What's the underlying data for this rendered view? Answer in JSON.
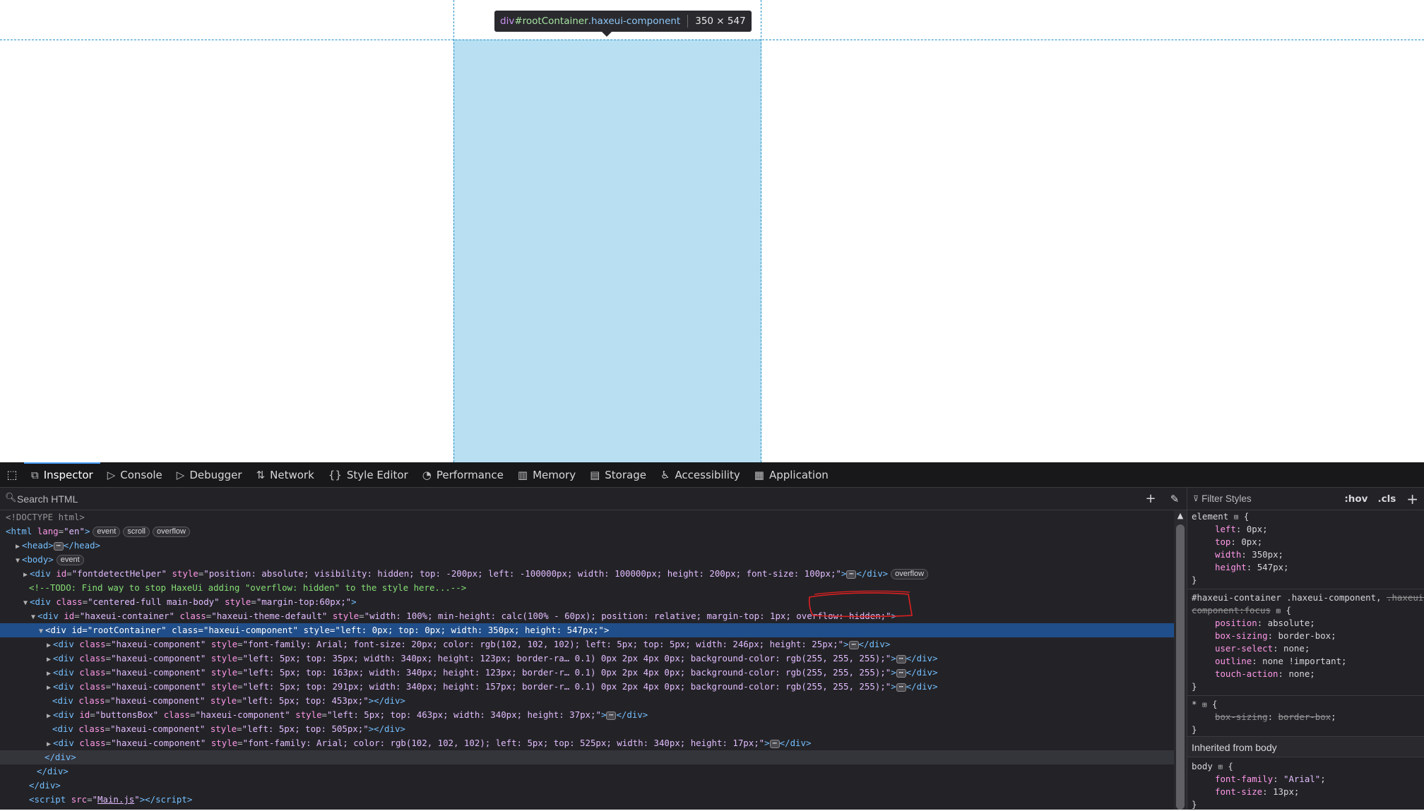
{
  "tooltip": {
    "tag": "div",
    "id": "#rootContainer",
    "classes": ".haxeui-component",
    "dims": "350 × 547"
  },
  "tabs": [
    {
      "label": "Inspector",
      "icon": "inspector-icon",
      "glyph": "⧉",
      "active": true
    },
    {
      "label": "Console",
      "icon": "console-icon",
      "glyph": "▷"
    },
    {
      "label": "Debugger",
      "icon": "debugger-icon",
      "glyph": "▷"
    },
    {
      "label": "Network",
      "icon": "network-icon",
      "glyph": "⇅"
    },
    {
      "label": "Style Editor",
      "icon": "style-editor-icon",
      "glyph": "{}"
    },
    {
      "label": "Performance",
      "icon": "performance-icon",
      "glyph": "◔"
    },
    {
      "label": "Memory",
      "icon": "memory-icon",
      "glyph": "▥"
    },
    {
      "label": "Storage",
      "icon": "storage-icon",
      "glyph": "▤"
    },
    {
      "label": "Accessibility",
      "icon": "accessibility-icon",
      "glyph": "♿"
    },
    {
      "label": "Application",
      "icon": "application-icon",
      "glyph": "▦"
    }
  ],
  "search_html": {
    "placeholder": "Search HTML"
  },
  "markup_lines": [
    {
      "html": "<span class=\"doc\">&lt;!DOCTYPE html&gt;</span>",
      "indent": 0
    },
    {
      "html": "<span class=\"tag\">&lt;html</span> <span class=\"attr\">lang</span>=<span class=\"val\">\"en\"</span><span class=\"tag\">&gt;</span><span class=\"badge\">event</span><span class=\"badge\">scroll</span><span class=\"badge\">overflow</span>",
      "indent": 0
    },
    {
      "html": "<span class=\"tw\">▶</span><span class=\"tag\">&lt;head&gt;</span><span class=\"ell\">⋯</span><span class=\"tag\">&lt;/head&gt;</span>",
      "indent": 1
    },
    {
      "html": "<span class=\"tw\">▼</span><span class=\"tag\">&lt;body&gt;</span><span class=\"badge\">event</span>",
      "indent": 1
    },
    {
      "html": "<span class=\"tw\">▶</span><span class=\"tag\">&lt;div</span> <span class=\"attr\">id</span>=<span class=\"val\">\"fontdetectHelper\"</span> <span class=\"attr\">style</span>=<span class=\"val\">\"position: absolute; visibility: hidden; top: -200px; left: -100000px; width: 100000px; height: 200px; font-size: 100px;\"</span><span class=\"tag\">&gt;</span><span class=\"ell\">⋯</span><span class=\"tag\">&lt;/div&gt;</span><span class=\"badge\">overflow</span>",
      "indent": 2
    },
    {
      "html": "<span class=\"com\">&lt;!--TODO: Find way to stop HaxeUi adding \"overflow: hidden\" to the style here...--&gt;</span>",
      "indent": 3
    },
    {
      "html": "<span class=\"tw\">▼</span><span class=\"tag\">&lt;div</span> <span class=\"attr\">class</span>=<span class=\"val\">\"centered-full main-body\"</span> <span class=\"attr\">style</span>=<span class=\"val\">\"margin-top:60px;\"</span><span class=\"tag\">&gt;</span>",
      "indent": 2
    },
    {
      "html": "<span class=\"tw\">▼</span><span class=\"tag\">&lt;div</span> <span class=\"attr\">id</span>=<span class=\"val\">\"haxeui-container\"</span> <span class=\"attr\">class</span>=<span class=\"val\">\"haxeui-theme-default\"</span> <span class=\"attr\">style</span>=<span class=\"val\">\"width: 100%; min-height: calc(100% - 60px); position: relative; margin-top: 1px; overflow: hidden;\"</span><span class=\"tag\">&gt;</span>",
      "indent": 3
    },
    {
      "html": "<span class=\"tw\">▼</span><span class=\"tag\">&lt;div</span> <span class=\"attr\">id</span>=<span class=\"val\">\"rootContainer\"</span> <span class=\"attr\">class</span>=<span class=\"val\">\"haxeui-component\"</span> <span class=\"attr\">style</span>=<span class=\"val\">\"left: 0px; top: 0px; width: 350px; height: 547px;\"</span><span class=\"tag\">&gt;</span>",
      "indent": 4,
      "selected": true
    },
    {
      "html": "<span class=\"tw\">▶</span><span class=\"tag\">&lt;div</span> <span class=\"attr\">class</span>=<span class=\"val\">\"haxeui-component\"</span> <span class=\"attr\">style</span>=<span class=\"val\">\"font-family: Arial; font-size: 20px; color: rgb(102, 102, 102); left: 5px; top: 5px; width: 246px; height: 25px;\"</span><span class=\"tag\">&gt;</span><span class=\"ell\">⋯</span><span class=\"tag\">&lt;/div&gt;</span>",
      "indent": 5
    },
    {
      "html": "<span class=\"tw\">▶</span><span class=\"tag\">&lt;div</span> <span class=\"attr\">class</span>=<span class=\"val\">\"haxeui-component\"</span> <span class=\"attr\">style</span>=<span class=\"val\">\"left: 5px; top: 35px; width: 340px; height: 123px; border-ra… 0.1) 0px 2px 4px 0px; background-color: rgb(255, 255, 255);\"</span><span class=\"tag\">&gt;</span><span class=\"ell\">⋯</span><span class=\"tag\">&lt;/div&gt;</span>",
      "indent": 5
    },
    {
      "html": "<span class=\"tw\">▶</span><span class=\"tag\">&lt;div</span> <span class=\"attr\">class</span>=<span class=\"val\">\"haxeui-component\"</span> <span class=\"attr\">style</span>=<span class=\"val\">\"left: 5px; top: 163px; width: 340px; height: 123px; border-r… 0.1) 0px 2px 4px 0px; background-color: rgb(255, 255, 255);\"</span><span class=\"tag\">&gt;</span><span class=\"ell\">⋯</span><span class=\"tag\">&lt;/div&gt;</span>",
      "indent": 5
    },
    {
      "html": "<span class=\"tw\">▶</span><span class=\"tag\">&lt;div</span> <span class=\"attr\">class</span>=<span class=\"val\">\"haxeui-component\"</span> <span class=\"attr\">style</span>=<span class=\"val\">\"left: 5px; top: 291px; width: 340px; height: 157px; border-r… 0.1) 0px 2px 4px 0px; background-color: rgb(255, 255, 255);\"</span><span class=\"tag\">&gt;</span><span class=\"ell\">⋯</span><span class=\"tag\">&lt;/div&gt;</span>",
      "indent": 5
    },
    {
      "html": "<span class=\"tag\">&lt;div</span> <span class=\"attr\">class</span>=<span class=\"val\">\"haxeui-component\"</span> <span class=\"attr\">style</span>=<span class=\"val\">\"left: 5px; top: 453px;\"</span><span class=\"tag\">&gt;&lt;/div&gt;</span>",
      "indent": 6
    },
    {
      "html": "<span class=\"tw\">▶</span><span class=\"tag\">&lt;div</span> <span class=\"attr\">id</span>=<span class=\"val\">\"buttonsBox\"</span> <span class=\"attr\">class</span>=<span class=\"val\">\"haxeui-component\"</span> <span class=\"attr\">style</span>=<span class=\"val\">\"left: 5px; top: 463px; width: 340px; height: 37px;\"</span><span class=\"tag\">&gt;</span><span class=\"ell\">⋯</span><span class=\"tag\">&lt;/div&gt;</span>",
      "indent": 5
    },
    {
      "html": "<span class=\"tag\">&lt;div</span> <span class=\"attr\">class</span>=<span class=\"val\">\"haxeui-component\"</span> <span class=\"attr\">style</span>=<span class=\"val\">\"left: 5px; top: 505px;\"</span><span class=\"tag\">&gt;&lt;/div&gt;</span>",
      "indent": 6
    },
    {
      "html": "<span class=\"tw\">▶</span><span class=\"tag\">&lt;div</span> <span class=\"attr\">class</span>=<span class=\"val\">\"haxeui-component\"</span> <span class=\"attr\">style</span>=<span class=\"val\">\"font-family: Arial; color: rgb(102, 102, 102); left: 5px; top: 525px; width: 340px; height: 17px;\"</span><span class=\"tag\">&gt;</span><span class=\"ell\">⋯</span><span class=\"tag\">&lt;/div&gt;</span>",
      "indent": 5
    },
    {
      "html": "<span class=\"tag\">&lt;/div&gt;</span>",
      "indent": 5,
      "closing": true
    },
    {
      "html": "<span class=\"tag\">&lt;/div&gt;</span>",
      "indent": 4
    },
    {
      "html": "<span class=\"tag\">&lt;/div&gt;</span>",
      "indent": 3
    },
    {
      "html": "<span class=\"tag\">&lt;script</span> <span class=\"attr\">src</span>=<span class=\"val\">\"<span class=\"link\">Main.js</span>\"</span><span class=\"tag\">&gt;&lt;/script&gt;</span>",
      "indent": 3
    }
  ],
  "styles": {
    "filter_placeholder": "Filter Styles",
    "hov": ":hov",
    "cls": ".cls",
    "element_rule": {
      "selector": "element",
      "props": [
        [
          "left",
          "0px"
        ],
        [
          "top",
          "0px"
        ],
        [
          "width",
          "350px"
        ],
        [
          "height",
          "547px"
        ]
      ]
    },
    "haxe_rule": {
      "selector_a": "#haxeui-container .haxeui-component, ",
      "selector_b": ".haxeui-",
      "selector_c": "component:focus",
      "props": [
        [
          "position",
          "absolute"
        ],
        [
          "box-sizing",
          "border-box"
        ],
        [
          "user-select",
          "none"
        ],
        [
          "outline",
          "none !important"
        ],
        [
          "touch-action",
          "none"
        ]
      ]
    },
    "star_rule": {
      "selector": "*",
      "props": [
        [
          "box-sizing",
          "border-box"
        ]
      ]
    },
    "inherited_label": "Inherited from body",
    "body_rule": {
      "selector": "body",
      "props": [
        [
          "font-family",
          "\"Arial\""
        ],
        [
          "font-size",
          "13px"
        ]
      ]
    }
  },
  "colors": {
    "highlight": "#b8e0f2",
    "guides": "#1f8fc7",
    "selected_row": "#204e8a",
    "annotation": "#e02020"
  }
}
